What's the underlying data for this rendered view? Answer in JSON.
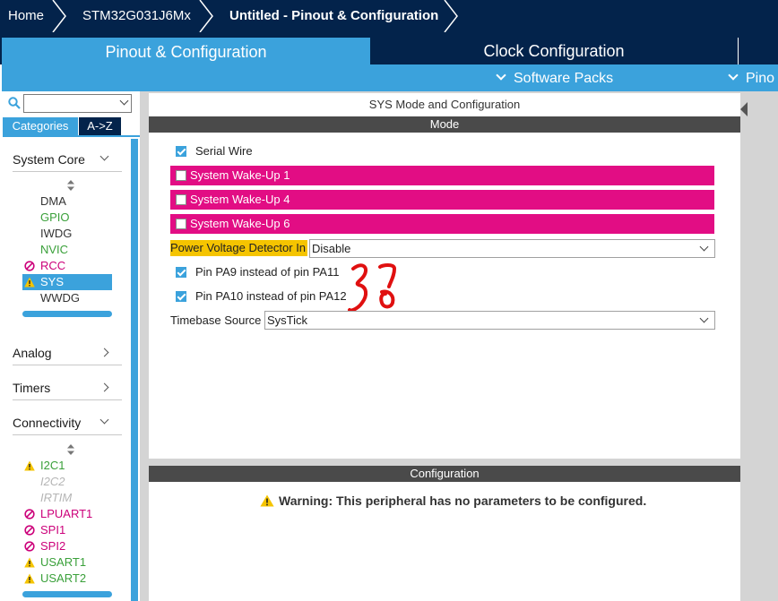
{
  "breadcrumb": [
    {
      "label": "Home"
    },
    {
      "label": "STM32G031J6Mx"
    },
    {
      "label": "Untitled - Pinout & Configuration"
    }
  ],
  "tabs": {
    "pinout": "Pinout & Configuration",
    "clock": "Clock Configuration"
  },
  "subbar": {
    "software_packs": "Software Packs",
    "pinout": "Pino"
  },
  "sidebar": {
    "search": {
      "value": ""
    },
    "categories_tab": "Categories",
    "az_tab": "A->Z",
    "sections": {
      "system_core": "System Core",
      "analog": "Analog",
      "timers": "Timers",
      "connectivity": "Connectivity"
    },
    "system_core_items": [
      {
        "label": "DMA",
        "status": "default"
      },
      {
        "label": "GPIO",
        "status": "green"
      },
      {
        "label": "IWDG",
        "status": "default"
      },
      {
        "label": "NVIC",
        "status": "green"
      },
      {
        "label": "RCC",
        "status": "disabled"
      },
      {
        "label": "SYS",
        "status": "warning-selected"
      },
      {
        "label": "WWDG",
        "status": "default"
      }
    ],
    "connectivity_items": [
      {
        "label": "I2C1",
        "status": "warning"
      },
      {
        "label": "I2C2",
        "status": "unavailable"
      },
      {
        "label": "IRTIM",
        "status": "unavailable"
      },
      {
        "label": "LPUART1",
        "status": "disabled"
      },
      {
        "label": "SPI1",
        "status": "disabled"
      },
      {
        "label": "SPI2",
        "status": "disabled"
      },
      {
        "label": "USART1",
        "status": "warning"
      },
      {
        "label": "USART2",
        "status": "warning"
      }
    ]
  },
  "mode_panel": {
    "title": "SYS Mode and Configuration",
    "mode_header": "Mode",
    "serial_wire": {
      "label": "Serial Wire",
      "checked": true
    },
    "wakeups": [
      {
        "label": "System Wake-Up 1",
        "checked": false
      },
      {
        "label": "System Wake-Up 4",
        "checked": false
      },
      {
        "label": "System Wake-Up 6",
        "checked": false
      }
    ],
    "pvd": {
      "label": "Power Voltage Detector In",
      "value": "Disable"
    },
    "pa9": {
      "label": "Pin PA9 instead of pin PA11",
      "checked": true
    },
    "pa10": {
      "label": "Pin PA10 instead of pin PA12",
      "checked": true
    },
    "timebase": {
      "label": "Timebase Source",
      "value": "SysTick"
    }
  },
  "config_panel": {
    "header": "Configuration",
    "warning": "Warning: This peripheral has no parameters to be configured."
  },
  "colors": {
    "navy": "#03234b",
    "accent": "#3ba2dc",
    "magenta": "#e20d84",
    "highlight": "#f5c400",
    "ok_green": "#3aa03a",
    "disabled_pink": "#cc007a",
    "annotation_red": "#e01010"
  }
}
